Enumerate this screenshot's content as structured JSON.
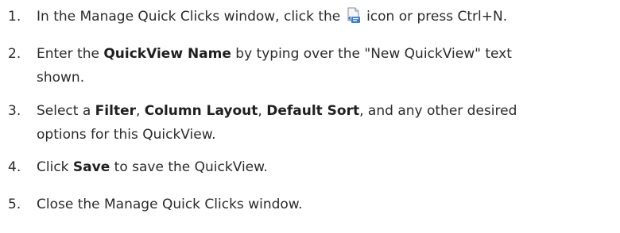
{
  "steps": [
    {
      "number": "1.",
      "before_icon": "In the Manage Quick Clicks window, click the",
      "icon": "new-quickview-icon",
      "after_icon": "icon or press Ctrl+N."
    },
    {
      "number": "2.",
      "line1_a": "Enter the",
      "line1_bold": "QuickView Name",
      "line1_b": "by typing over the \"New QuickView\" text",
      "line2": "shown."
    },
    {
      "number": "3.",
      "line1_a": "Select a",
      "bold1": "Filter",
      "sep1": ",",
      "bold2": "Column Layout",
      "sep2": ",",
      "bold3": "Default Sort",
      "line1_b": ", and any other desired",
      "line2": "options for this QuickView."
    },
    {
      "number": "4.",
      "text_a": "Click",
      "bold": "Save",
      "text_b": "to save the QuickView."
    },
    {
      "number": "5.",
      "text": "Close the Manage Quick Clicks window."
    }
  ],
  "colors": {
    "text": "#2b2b2b",
    "icon_blue": "#3a7fd0",
    "icon_page": "#f4f6f8"
  }
}
